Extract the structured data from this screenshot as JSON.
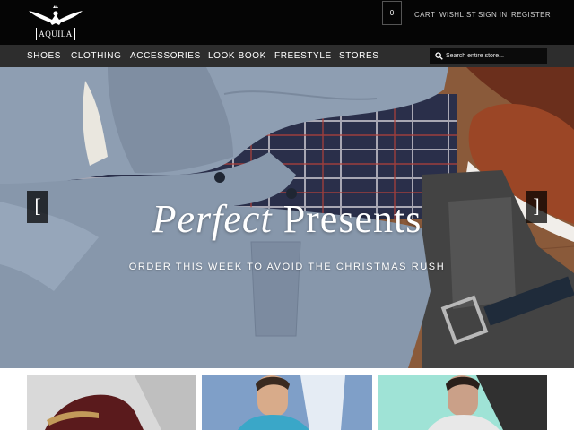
{
  "header": {
    "logo_text": "AQUILA",
    "cart_count": "0",
    "links": [
      "CART",
      "WISHLIST",
      "SIGN IN",
      "REGISTER"
    ]
  },
  "nav": {
    "items": [
      "SHOES",
      "CLOTHING",
      "ACCESSORIES",
      "LOOK BOOK",
      "FREESTYLE",
      "STORES"
    ]
  },
  "search": {
    "placeholder": "Search entire store...",
    "icon": "search-icon"
  },
  "hero": {
    "title_italic": "Perfect",
    "title_regular": "Presents",
    "subtitle": "ORDER THIS WEEK TO AVOID THE CHRISTMAS RUSH",
    "prev_label": "[",
    "next_label": "]"
  },
  "tiles": [
    "shoes-promo",
    "shirts-promo",
    "casual-promo"
  ],
  "colors": {
    "header_bg": "#050505",
    "nav_bg": "#2d2d2d",
    "text": "#ffffff",
    "jacket": "#8e9eb2",
    "wood": "#8a5a3a"
  }
}
